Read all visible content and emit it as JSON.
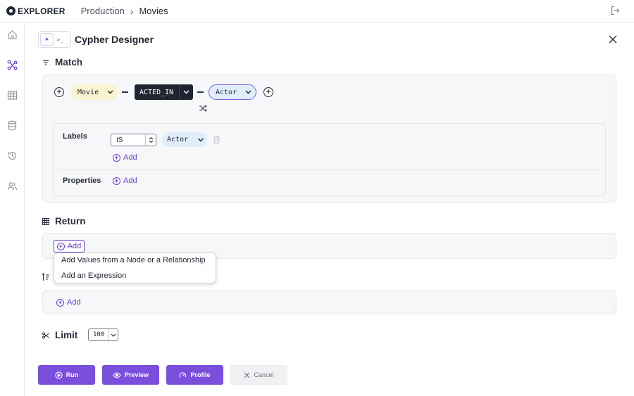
{
  "app": {
    "name": "EXPLORER"
  },
  "breadcrumb": {
    "parent": "Production",
    "current": "Movies"
  },
  "designer": {
    "title": "Cypher Designer"
  },
  "match": {
    "title": "Match",
    "source_node": "Movie",
    "relationship": "ACTED_IN",
    "target_node": "Actor",
    "labels_label": "Labels",
    "label_operator": "IS",
    "label_value": "Actor",
    "add_label": "Add",
    "properties_label": "Properties",
    "add_property": "Add"
  },
  "return": {
    "title": "Return",
    "add_label": "Add",
    "menu": [
      "Add Values from a Node or a Relationship",
      "Add an Expression"
    ]
  },
  "order": {
    "add_label": "Add"
  },
  "limit": {
    "title": "Limit",
    "value": "100"
  },
  "buttons": {
    "run": "Run",
    "preview": "Preview",
    "profile": "Profile",
    "cancel": "Cancel"
  },
  "colors": {
    "accent": "#7a4fdc",
    "node": "#fbf2cf",
    "label": "#e0eefb",
    "relationship": "#1f2430"
  }
}
